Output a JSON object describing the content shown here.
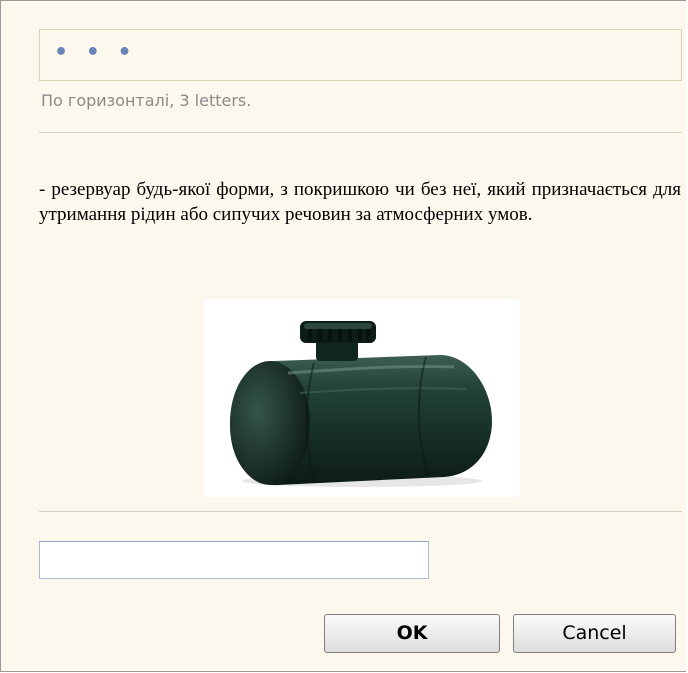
{
  "answer": {
    "pattern": "• • •"
  },
  "hint": {
    "text": "По горизонталі, 3 letters."
  },
  "clue": {
    "text": "- резервуар будь-якої форми, з покришкою чи без неї, який призначається для утримання рідин або сипучих речовин за атмосферних умов."
  },
  "illustration": {
    "subject": "tank-image",
    "body_color": "#1f3a30",
    "cap_color": "#101d18"
  },
  "input": {
    "value": "",
    "placeholder": ""
  },
  "buttons": {
    "ok_label": "OK",
    "cancel_label": "Cancel"
  },
  "colors": {
    "background": "#fdf8ee",
    "dots": "#6a84b8",
    "hint": "#8a8a8a"
  }
}
